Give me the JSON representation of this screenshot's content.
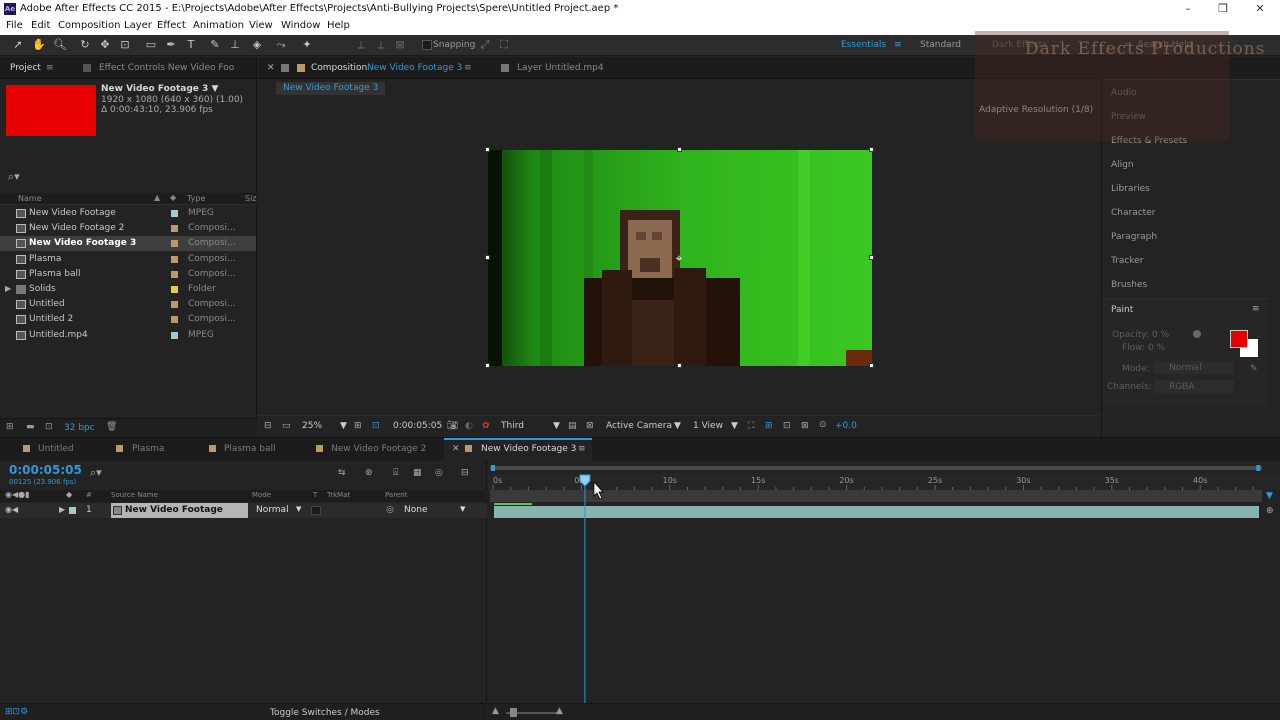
{
  "window": {
    "title": "Adobe After Effects CC 2015 - E:\\Projects\\Adobe\\After Effects\\Projects\\Anti-Bullying Projects\\Spere\\Untitled Project.aep *",
    "app_icon": "Ae"
  },
  "menu": [
    "File",
    "Edit",
    "Composition",
    "Layer",
    "Effect",
    "Animation",
    "View",
    "Window",
    "Help"
  ],
  "toolbar": {
    "snapping": "Snapping",
    "workspaces": [
      "Essentials",
      "Standard",
      "Dark Effects"
    ],
    "search_placeholder": "Search Help"
  },
  "project_panel": {
    "tab": "Project",
    "effect_controls_tab": "Effect Controls New Video Foo",
    "footage_name": "New Video Footage 3 ▼",
    "footage_res": "1920 x 1080  (640 x 360) (1.00)",
    "footage_dur": "Δ 0:00:43:10, 23.906 fps",
    "thumb_color": "#e60000",
    "columns": {
      "name": "Name",
      "type": "Type",
      "size": "Siz"
    },
    "items": [
      {
        "name": "New Video Footage",
        "type": "MPEG",
        "label": "#a8c8d0",
        "selected": false
      },
      {
        "name": "New Video Footage 2",
        "type": "Composi...",
        "label": "#b89a6b",
        "selected": false
      },
      {
        "name": "New Video Footage 3",
        "type": "Composi...",
        "label": "#b89a6b",
        "selected": true
      },
      {
        "name": "Plasma",
        "type": "Composi...",
        "label": "#b89a6b",
        "selected": false
      },
      {
        "name": "Plasma ball",
        "type": "Composi...",
        "label": "#b89a6b",
        "selected": false
      },
      {
        "name": "Solids",
        "type": "Folder",
        "label": "#e0d040",
        "selected": false
      },
      {
        "name": "Untitled",
        "type": "Composi...",
        "label": "#b89a6b",
        "selected": false
      },
      {
        "name": "Untitled 2",
        "type": "Composi...",
        "label": "#b89a6b",
        "selected": false
      },
      {
        "name": "Untitled.mp4",
        "type": "MPEG",
        "label": "#a8c8d0",
        "selected": false
      }
    ],
    "bpc": "32 bpc"
  },
  "composition_panel": {
    "tab_prefix": "Composition",
    "tab_comp": "New Video Footage 3",
    "layer_tab": "Layer  Untitled.mp4",
    "flowchart": "New Video Footage 3",
    "zoom": "25%",
    "timecode": "0:00:05:05",
    "resolution": "Third",
    "camera": "Active Camera",
    "views": "1 View",
    "exposure": "+0.0",
    "adaptive": "Adaptive Resolution (1/8)"
  },
  "right_panel": {
    "items": [
      "Audio",
      "Preview",
      "Effects & Presets",
      "Align",
      "Libraries",
      "Character",
      "Paragraph",
      "Tracker",
      "Brushes"
    ],
    "paint": {
      "title": "Paint",
      "opacity": "Opacity:  0 %",
      "flow": "Flow:  0 %",
      "mode_label": "Mode:",
      "mode": "Normal",
      "channels_label": "Channels:",
      "channels": "RGBA",
      "fg_color": "#e60000",
      "bg_color": "#ffffff"
    }
  },
  "watermark": "Dark Effects Productions",
  "timeline": {
    "tabs": [
      "Untitled",
      "Plasma",
      "Plasma ball",
      "New Video Footage 2",
      "New Video Footage 3"
    ],
    "timecode": "0:00:05:05",
    "frames": "00125 (23.906 fps)",
    "columns": {
      "source": "Source Name",
      "mode": "Mode",
      "t": "T",
      "trkmat": "TrkMat",
      "parent": "Parent"
    },
    "layer": {
      "num": "1",
      "name": "New Video Footage",
      "mode": "Normal",
      "parent": "None"
    },
    "ruler": [
      "0s",
      "05s",
      "10s",
      "15s",
      "20s",
      "25s",
      "30s",
      "35s",
      "40s"
    ],
    "duration_s": 43.4,
    "current_s": 5.2,
    "footer": "Toggle Switches / Modes"
  }
}
